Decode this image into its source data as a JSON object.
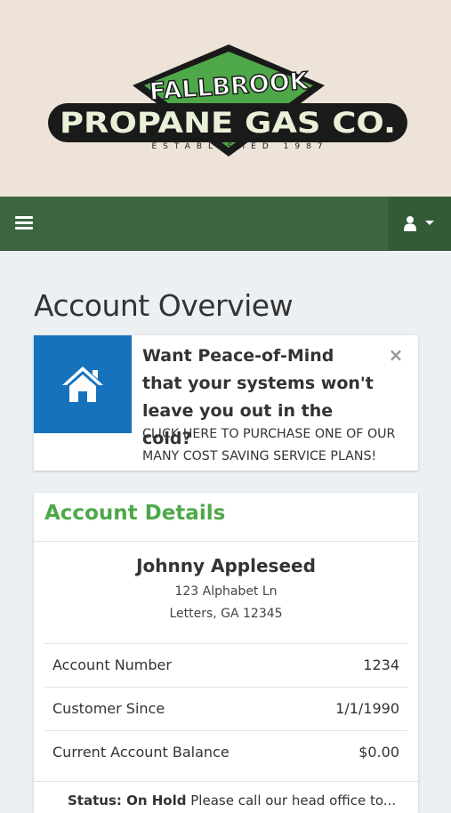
{
  "brand": {
    "arc_text": "FALLBROOK",
    "name_text": "PROPANE GAS CO.",
    "tagline": "ESTABLISHED 1987"
  },
  "navbar": {
    "menu_icon": "hamburger-icon",
    "user_icon": "user-icon",
    "dropdown_icon": "caret-down-icon"
  },
  "page": {
    "title": "Account Overview"
  },
  "promo": {
    "icon": "home-icon",
    "heading": "Want Peace-of-Mind that your systems won't leave you out in the cold?",
    "subtext": "CLICK HERE TO PURCHASE ONE OF OUR MANY COST SAVING SERVICE PLANS!",
    "close_glyph": "×"
  },
  "account_details": {
    "heading": "Account Details",
    "customer_name": "Johnny Appleseed",
    "address_line1": "123 Alphabet Ln",
    "address_line2": "Letters, GA 12345",
    "rows": [
      {
        "label": "Account Number",
        "value": "1234"
      },
      {
        "label": "Customer Since",
        "value": "1/1/1990"
      },
      {
        "label": "Current Account Balance",
        "value": "$0.00"
      }
    ],
    "status_label": "Status: On Hold",
    "status_message": "Please call our head office to..."
  },
  "colors": {
    "brand_background": "#ede3d8",
    "navbar": "#3d6640",
    "promo_icon_bg": "#1672bd",
    "heading_green": "#4ea84a"
  }
}
